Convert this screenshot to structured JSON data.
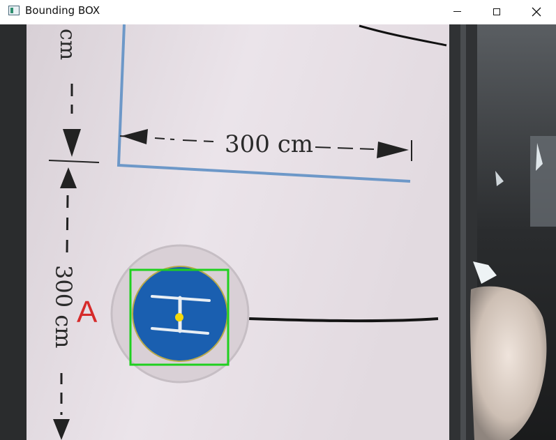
{
  "window": {
    "title": "Bounding BOX",
    "controls": {
      "minimize": "minimize",
      "maximize": "maximize",
      "close": "close"
    }
  },
  "icons": {
    "app": "app-window-icon",
    "minimize": "minimize-icon",
    "maximize": "maximize-icon",
    "close": "close-icon"
  },
  "feed": {
    "dimension_horizontal": "300 cm",
    "dimension_vertical": "300 cm",
    "dimension_top_fragment": "cm",
    "point_label": "A",
    "symbol_letter": "H"
  },
  "detection": {
    "box_color": "#1fd01f",
    "center_color": "#f5d90a",
    "symbol_fill": "#1a5fb0",
    "label_color": "#d62a2a"
  }
}
